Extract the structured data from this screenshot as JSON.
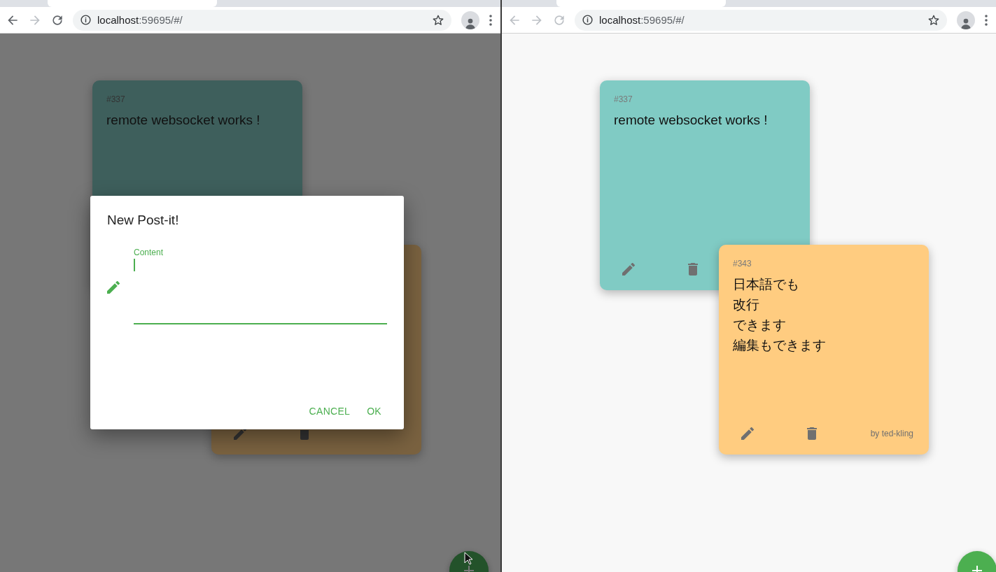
{
  "windows": [
    {
      "dimmed": true,
      "toolbar": {
        "back_disabled": false,
        "forward_disabled": true,
        "reload_disabled": false,
        "url_host": "localhost",
        "url_rest": ":59695/#/"
      },
      "notes": [
        {
          "id": "#337",
          "lines": [
            "remote websocket works !"
          ],
          "color": "#3e5f5c"
        },
        {
          "color": "#7a6240"
        }
      ],
      "dialog": {
        "title": "New Post-it!",
        "field": {
          "label": "Content",
          "focused": true
        },
        "buttons": [
          "CANCEL",
          "OK"
        ]
      },
      "pointer": true
    },
    {
      "dimmed": false,
      "toolbar": {
        "back_disabled": true,
        "forward_disabled": true,
        "reload_disabled": true,
        "url_host": "localhost",
        "url_rest": ":59695/#/"
      },
      "notes": [
        {
          "id": "#337",
          "lines": [
            "remote websocket works !"
          ],
          "color": "#80cbc4"
        },
        {
          "id": "#343",
          "lines": [
            "日本語でも",
            "改行",
            "できます",
            "編集もできます"
          ],
          "author": "by ted-kling",
          "color": "#ffcc80"
        }
      ]
    }
  ]
}
